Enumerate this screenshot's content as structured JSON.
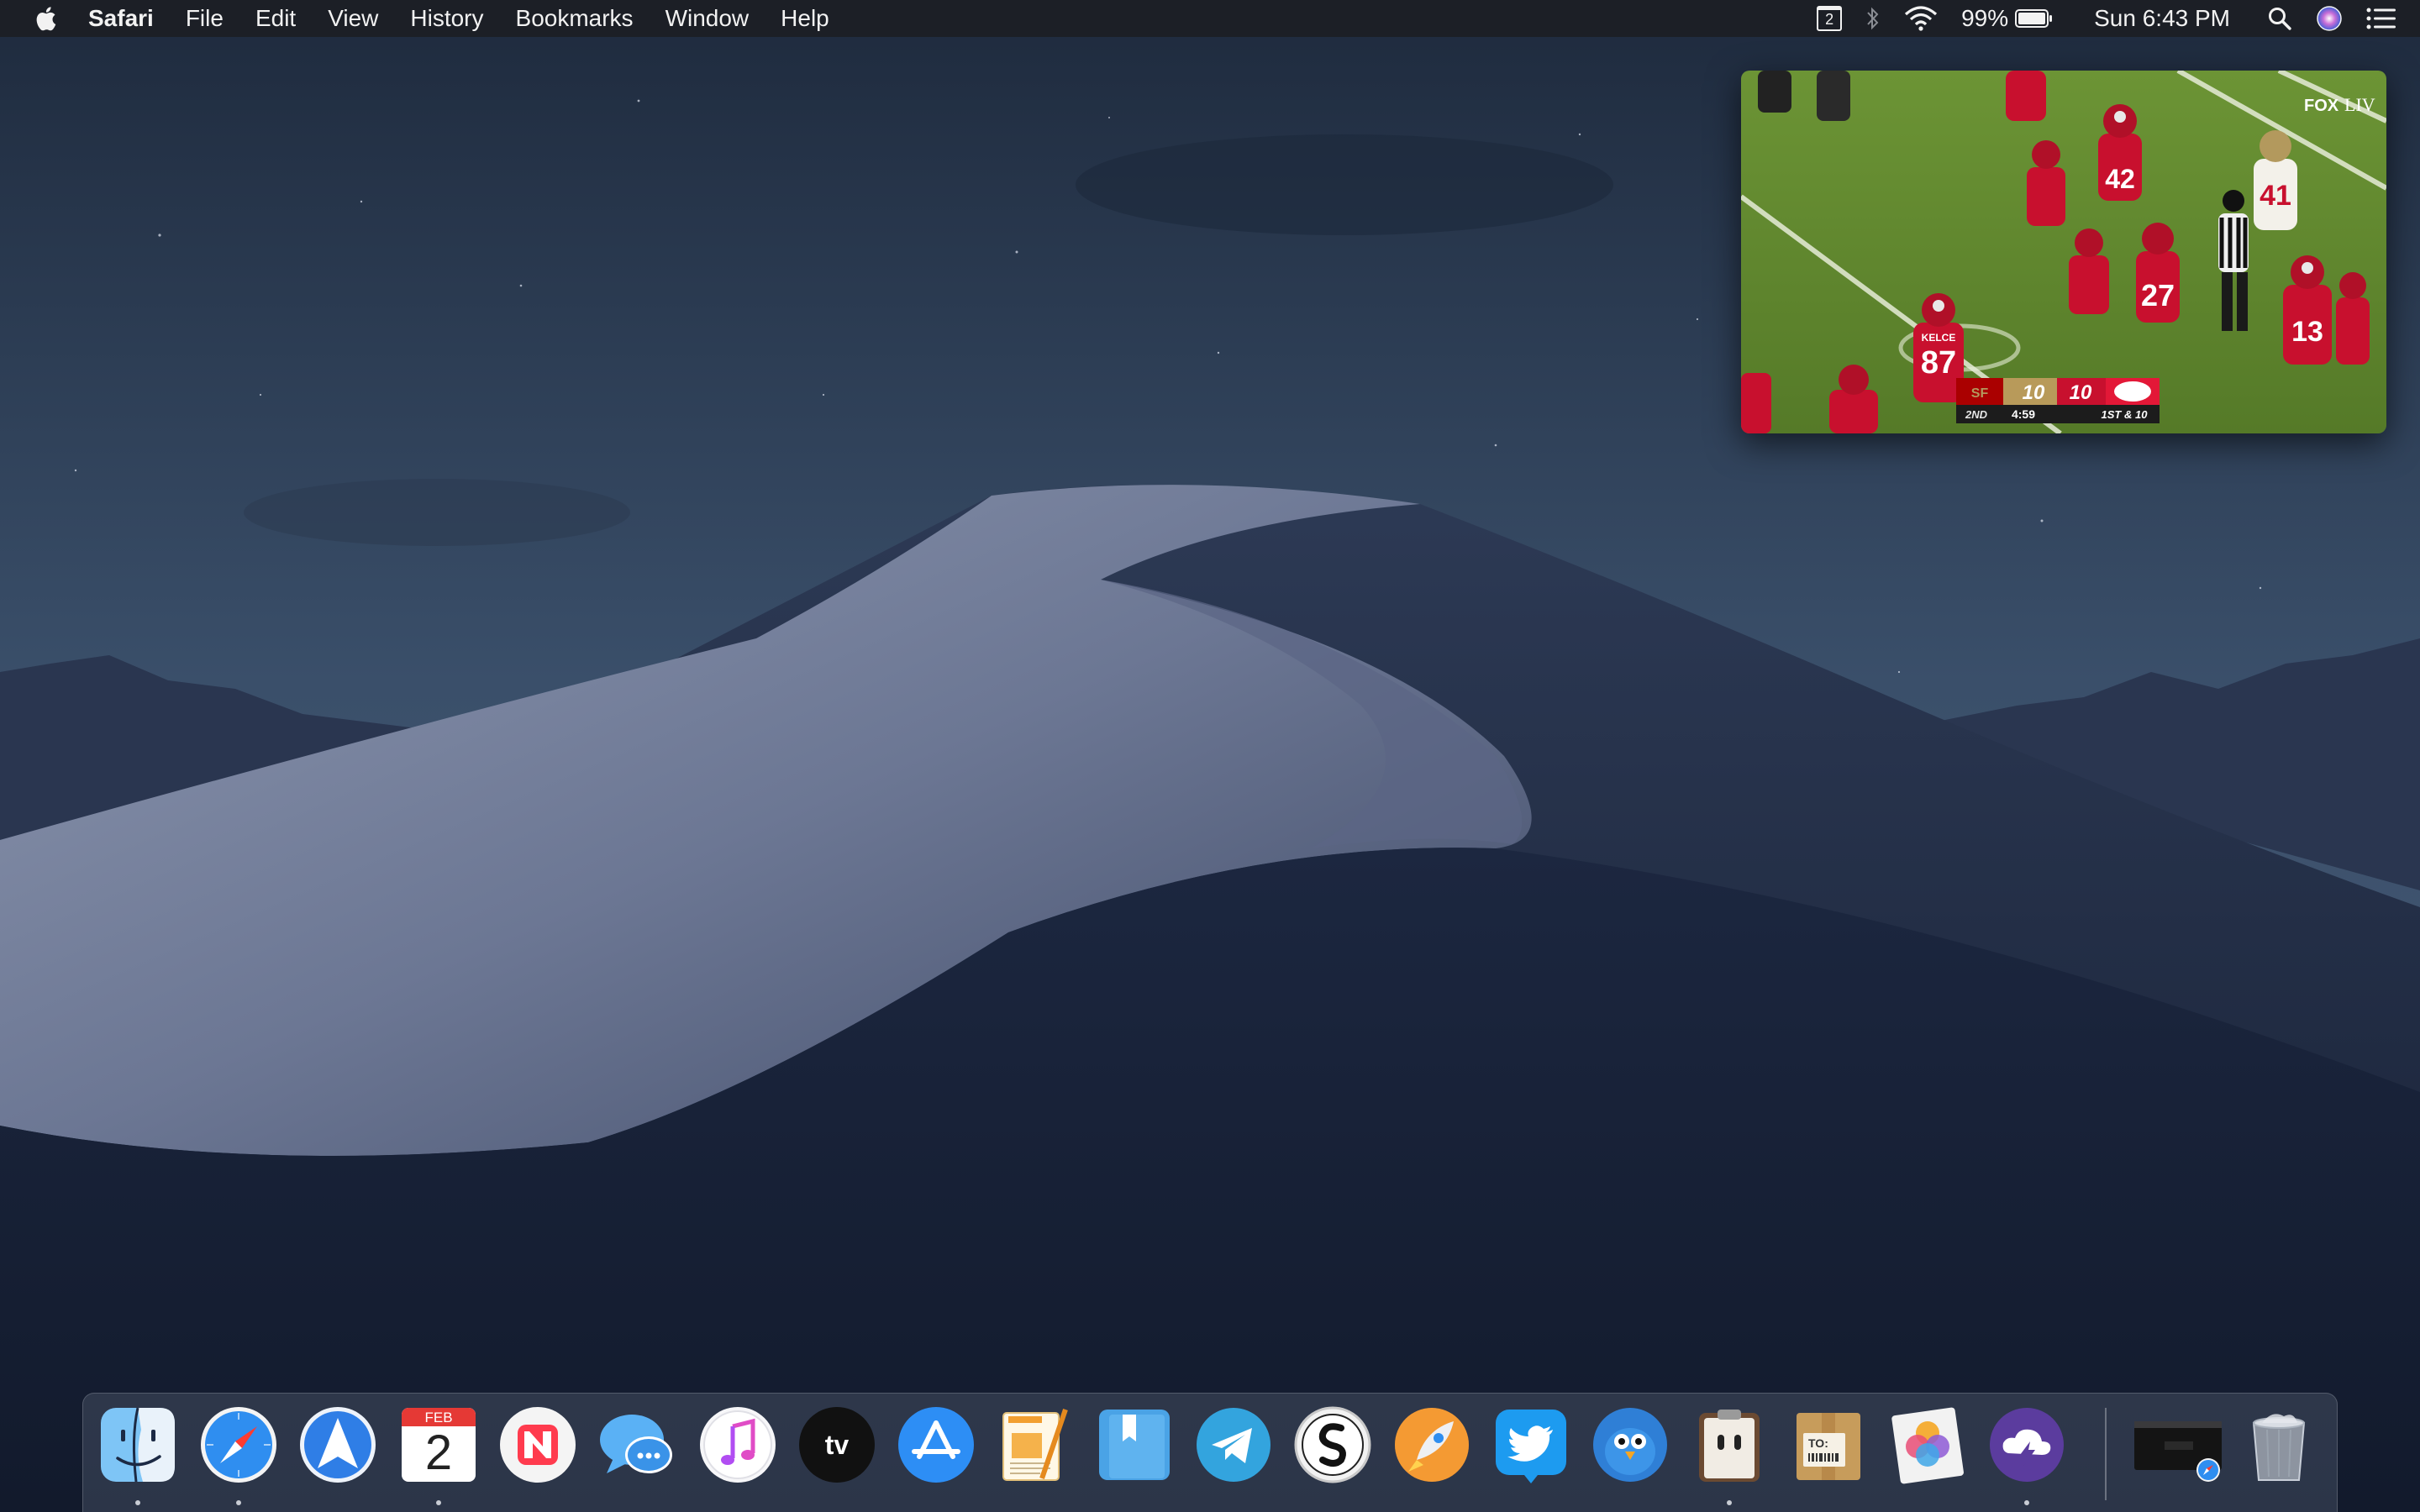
{
  "menubar": {
    "app_name": "Safari",
    "menus": [
      "File",
      "Edit",
      "View",
      "History",
      "Bookmarks",
      "Window",
      "Help"
    ],
    "status": {
      "desktop_space": "2",
      "battery_percent": "99%",
      "clock": "Sun 6:43 PM"
    },
    "icons": [
      "apple-logo-icon",
      "spaces-icon",
      "bluetooth-icon",
      "wifi-icon",
      "battery-icon",
      "spotlight-search-icon",
      "siri-icon",
      "notification-center-icon"
    ]
  },
  "pip": {
    "network_logo": "FOX",
    "event_logo": "LIV",
    "scoreboard": {
      "away_team_abbr": "SF",
      "away_score": "10",
      "home_score": "10",
      "quarter": "2ND",
      "clock": "4:59",
      "down_distance": "1ST & 10"
    },
    "jersey_numbers": [
      "87",
      "27",
      "13",
      "42",
      "41"
    ],
    "jersey_name": "KELCE",
    "field_color": "#5f8a2e",
    "home_team_color": "#c8102e"
  },
  "dock": {
    "apps": [
      {
        "name": "Finder",
        "running": true
      },
      {
        "name": "Safari",
        "running": true
      },
      {
        "name": "Spark",
        "running": false
      },
      {
        "name": "Calendar",
        "running": true,
        "month": "FEB",
        "day": "2"
      },
      {
        "name": "News",
        "running": false
      },
      {
        "name": "Messages",
        "running": false
      },
      {
        "name": "iTunes",
        "running": false
      },
      {
        "name": "TV",
        "running": false,
        "label": "tv"
      },
      {
        "name": "App Store",
        "running": false
      },
      {
        "name": "Pages",
        "running": false
      },
      {
        "name": "Day One",
        "running": false
      },
      {
        "name": "Telegram",
        "running": false
      },
      {
        "name": "Scrivener",
        "running": false
      },
      {
        "name": "Rocket Typist",
        "running": false
      },
      {
        "name": "Twitter",
        "running": false
      },
      {
        "name": "Tweetbot",
        "running": false
      },
      {
        "name": "Pastebot",
        "running": true
      },
      {
        "name": "Deliveries",
        "running": false,
        "label": "TO:"
      },
      {
        "name": "Pixelmator Photo",
        "running": false
      },
      {
        "name": "CloudMounter",
        "running": true
      }
    ],
    "minimized_window": "Safari window",
    "trash": "Trash"
  }
}
